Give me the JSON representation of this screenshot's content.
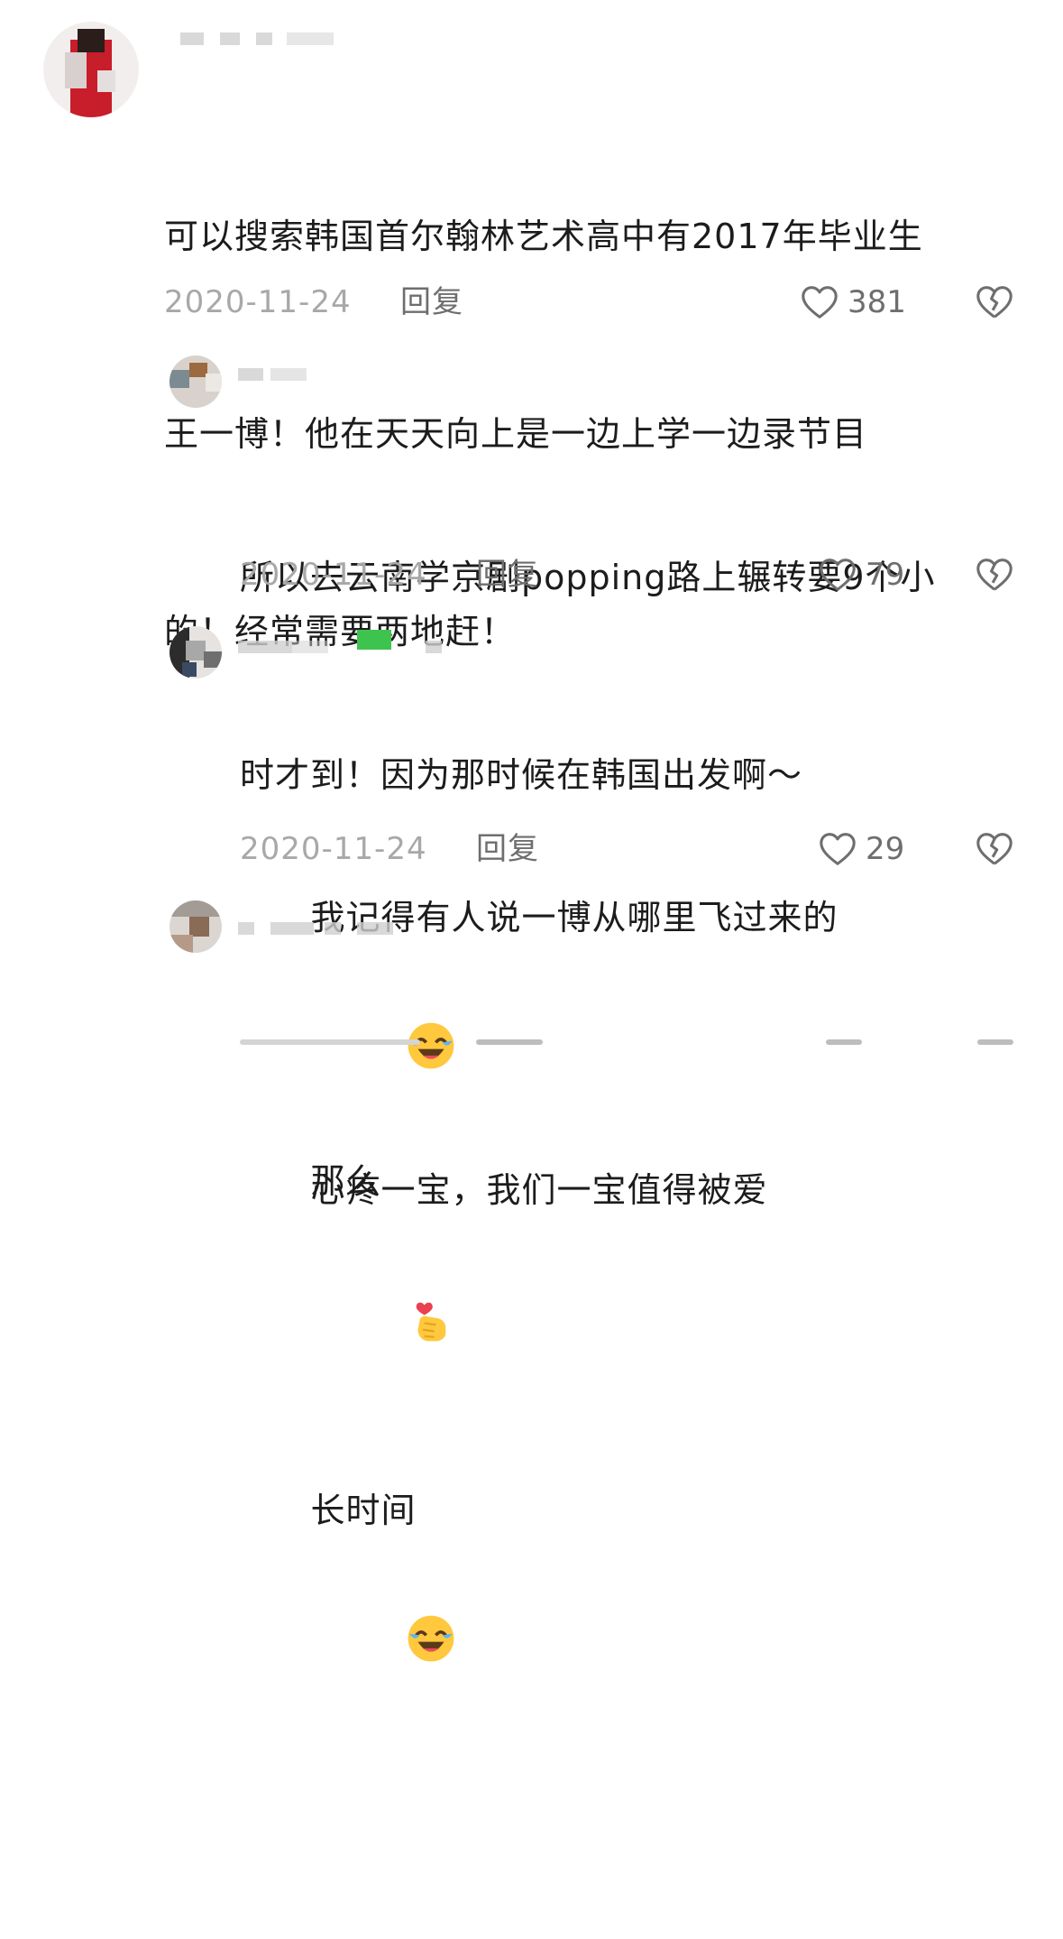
{
  "comments": [
    {
      "text_parts": [
        "可以搜索韩国首尔翰林艺术高中有2017年毕业生",
        "王一博！他在天天向上是一边上学一边录节目",
        "的！经常需要两地赶！"
      ],
      "date": "2020-11-24",
      "reply_label": "回复",
      "likes": "381"
    },
    {
      "text_parts": [
        "所以去云南学京剧popping路上辗转要9个小",
        "时才到！因为那时候在韩国出发啊～"
      ],
      "date": "2020-11-24",
      "reply_label": "回复",
      "likes": "79"
    },
    {
      "line1_before": "我记得有人说一博从哪里飞过来的",
      "line1_after": "那么",
      "line2_before": "长时间",
      "emoji_name": "laughing-crying-face-icon",
      "date": "2020-11-24",
      "reply_label": "回复",
      "likes": "29"
    },
    {
      "text_before": "心疼一宝，我们一宝值得被爱",
      "emoji_name": "finger-heart-icon"
    }
  ],
  "colors": {
    "text": "#1c1c1c",
    "meta_gray": "#a8a8a8",
    "icon_gray": "#6e6e6e"
  }
}
